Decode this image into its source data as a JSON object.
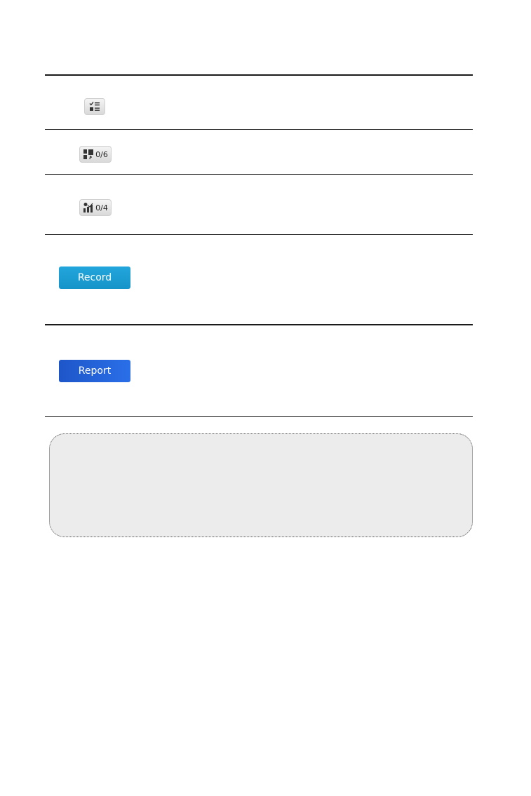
{
  "rows": [
    {
      "icon": "checklist-icon",
      "count": ""
    },
    {
      "icon": "component-grid-icon",
      "count": "0/6"
    },
    {
      "icon": "dashboard-chart-icon",
      "count": "0/4"
    }
  ],
  "buttons": {
    "record_label": "Record",
    "report_label": "Report"
  },
  "colors": {
    "record": "#1a9ed2",
    "report": "#2462d6",
    "note_background": "#ececec"
  }
}
